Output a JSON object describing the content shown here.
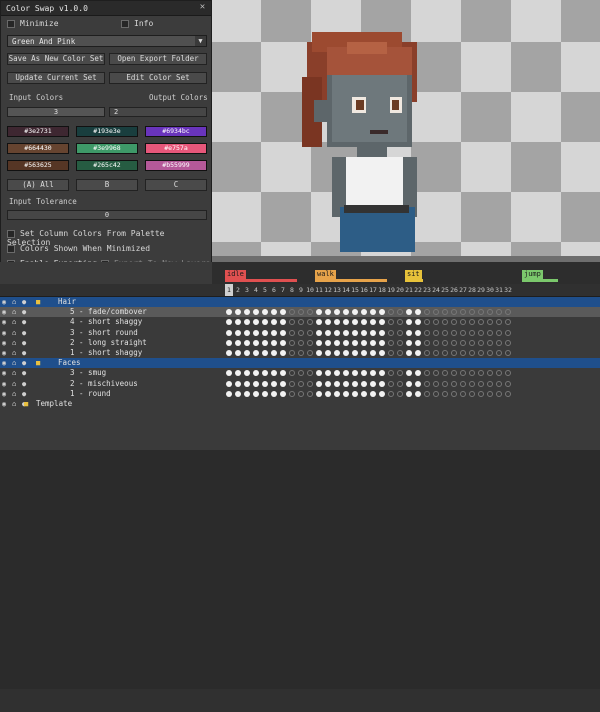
{
  "dialog": {
    "title": "Color Swap v1.0.0",
    "minimize_label": "Minimize",
    "info_label": "Info",
    "preset_selected": "Green And Pink",
    "buttons": {
      "save_as_new": "Save As New Color Set",
      "open_export": "Open Export Folder",
      "update_current": "Update Current Set",
      "edit_color": "Edit Color Set"
    },
    "input_colors_label": "Input Colors",
    "output_colors_label": "Output Colors",
    "input_colors_value": "3",
    "output_colors_value": "2",
    "swatches": [
      {
        "hex": "#3e2731",
        "color": "#3e2731"
      },
      {
        "hex": "#193e3e",
        "color": "#193e3e"
      },
      {
        "hex": "#6934bc",
        "color": "#6934bc"
      },
      {
        "hex": "#664430",
        "color": "#664430"
      },
      {
        "hex": "#3e9968",
        "color": "#3e9968"
      },
      {
        "hex": "#e757a",
        "color": "#e7577a"
      },
      {
        "hex": "#563625",
        "color": "#563625"
      },
      {
        "hex": "#265c42",
        "color": "#265c42"
      },
      {
        "hex": "#b55999",
        "color": "#b55999"
      }
    ],
    "col_buttons": [
      "(A) All",
      "B",
      "C"
    ],
    "input_tolerance_label": "Input Tolerance",
    "input_tolerance_value": "0",
    "opt_set_columns": "Set Column Colors From Palette Selection",
    "opt_colors_shown": "Colors Shown When Minimized",
    "opt_enable_exporting": "Enable Exporting",
    "opt_export_new_layers": "Export To New Layers"
  },
  "timeline": {
    "tags": [
      {
        "name": "idle",
        "color": "#e05050",
        "start": 1,
        "end": 8
      },
      {
        "name": "walk",
        "color": "#e7a34a",
        "start": 11,
        "end": 18
      },
      {
        "name": "sit",
        "color": "#e7c23a",
        "start": 21,
        "end": 22
      },
      {
        "name": "jump",
        "color": "#7bc86c",
        "start": 34,
        "end": 37
      }
    ],
    "frames": [
      "1",
      "2",
      "3",
      "4",
      "5",
      "6",
      "7",
      "8",
      "9",
      "10",
      "11",
      "12",
      "13",
      "14",
      "15",
      "16",
      "17",
      "18",
      "19",
      "20",
      "21",
      "22",
      "23",
      "24",
      "25",
      "26",
      "27",
      "28",
      "29",
      "30",
      "31",
      "32"
    ],
    "current_frame": "1",
    "layers": [
      {
        "name": "Hair",
        "type": "folder"
      },
      {
        "name": "5 - fade/combover",
        "type": "layer",
        "selected": true
      },
      {
        "name": "4 - short shaggy",
        "type": "layer"
      },
      {
        "name": "3 - short round",
        "type": "layer"
      },
      {
        "name": "2 - long straight",
        "type": "layer"
      },
      {
        "name": "1 - short shaggy",
        "type": "layer"
      },
      {
        "name": "Faces",
        "type": "folder"
      },
      {
        "name": "3 - smug",
        "type": "layer"
      },
      {
        "name": "2 - mischiveous",
        "type": "layer"
      },
      {
        "name": "1 - round",
        "type": "layer"
      },
      {
        "name": "Template",
        "type": "folder-root"
      }
    ]
  },
  "colors": {
    "panel": "#3c3c3c",
    "folder_highlight": "#1f4f8c",
    "selected_row": "#5a5a5a"
  }
}
